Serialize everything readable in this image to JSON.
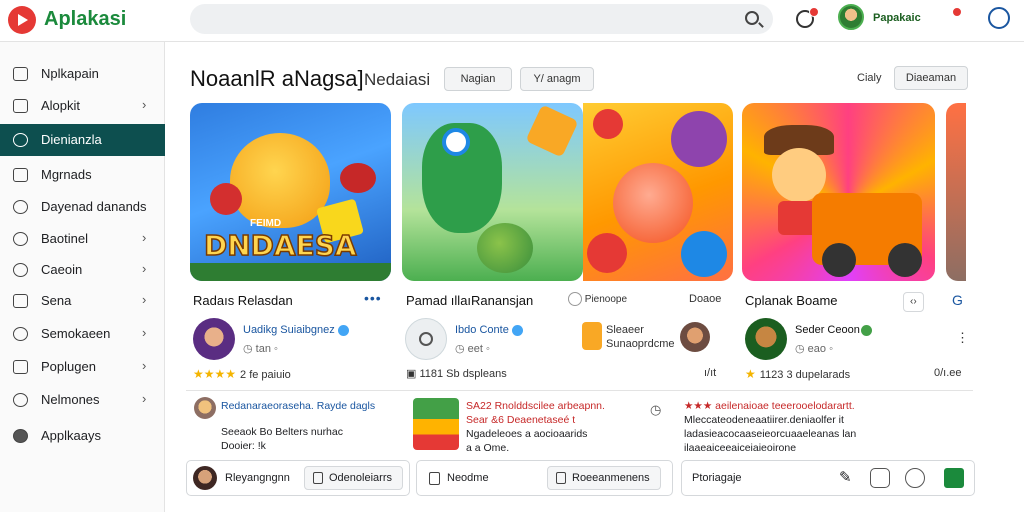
{
  "app": {
    "name": "Aplakasi",
    "search_placeholder": "",
    "user_name": "Papakaic"
  },
  "sidebar": {
    "items": [
      {
        "label": "Nplkapain",
        "chevron": false
      },
      {
        "label": "Alopkit",
        "chevron": true
      },
      {
        "label": "Dienianzla",
        "chevron": false,
        "active": true
      },
      {
        "label": "Mgrnads",
        "chevron": false
      },
      {
        "label": "Dayenad danands",
        "chevron": false
      },
      {
        "label": "Baotinel",
        "chevron": true
      },
      {
        "label": "Caeoin",
        "chevron": true
      },
      {
        "label": "Sena",
        "chevron": true
      },
      {
        "label": "Semokaeen",
        "chevron": true
      },
      {
        "label": "Poplugen",
        "chevron": true
      },
      {
        "label": "Nelmones",
        "chevron": true
      },
      {
        "label": "Applkaays",
        "chevron": false
      }
    ]
  },
  "main": {
    "title": "NoaanlR aNagsa]",
    "subtitle": "Nedaiasi",
    "filters": [
      "Nagian",
      "Y/ anagm"
    ],
    "sort_label": "Cialy",
    "sort_button": "Diaeaman"
  },
  "cards": [
    {
      "title": "Radaıs Relasdan",
      "banner_text": "DNDAESA",
      "banner_top": "FEIMD",
      "dev_name": "Uadikg Suiaibgnez",
      "dev_meta": "tan",
      "rating_text": "2 fe paiuio"
    },
    {
      "title": "Pamad ıllaıRanansjan",
      "chip": "Pienoope",
      "dev_name": "Ibdo Conte",
      "dev_meta": "eet",
      "rating_text": "1181 Sb dspleans"
    },
    {
      "title": "",
      "chip": "Doaoe",
      "dev_name": "Sleaeer\nSunaoprdcme",
      "rating_text": "ı/ıt"
    },
    {
      "title": "Cplanak Boame",
      "dev_name": "Seder Ceoon",
      "dev_meta": "eao",
      "rating_text": "1123 3 dupelarads",
      "side_text": "0/ı.ee"
    }
  ],
  "feed": [
    {
      "line1": "Redanaraeoraseha. Rayde dagls",
      "line2": "Seeaok Bo Belters nurhac",
      "line3": "Dooier: !k"
    },
    {
      "line1": "SA22 Rnolddscilee arbeapnn.",
      "line2": "Sear &6 Deaenetaseé t ",
      "line3": "Ngadeleoes a aocioaarids",
      "line4": "a a Ome."
    },
    {
      "line1": "★★★ aeilenaioae teeerooelodarartt.",
      "line2": "Mleccateodeneaatiirer.deniaolfer it",
      "line3": "ladasieacocaaseieorcuaaeleanas lan",
      "line4": "ilaaeaiceeaiceiaieoirone"
    }
  ],
  "bottom": {
    "box1": {
      "name": "Rleyangngnn",
      "button": "Odenoleiarrs"
    },
    "box2": {
      "name": "Neodme",
      "button": "Roeeanmenens"
    },
    "box3": {
      "name": "Ptoriagaje"
    }
  },
  "colors": {
    "accent": "#0d4f4f",
    "brand": "#1b8a3c",
    "badge": "#e53935",
    "star": "#f4b400"
  }
}
